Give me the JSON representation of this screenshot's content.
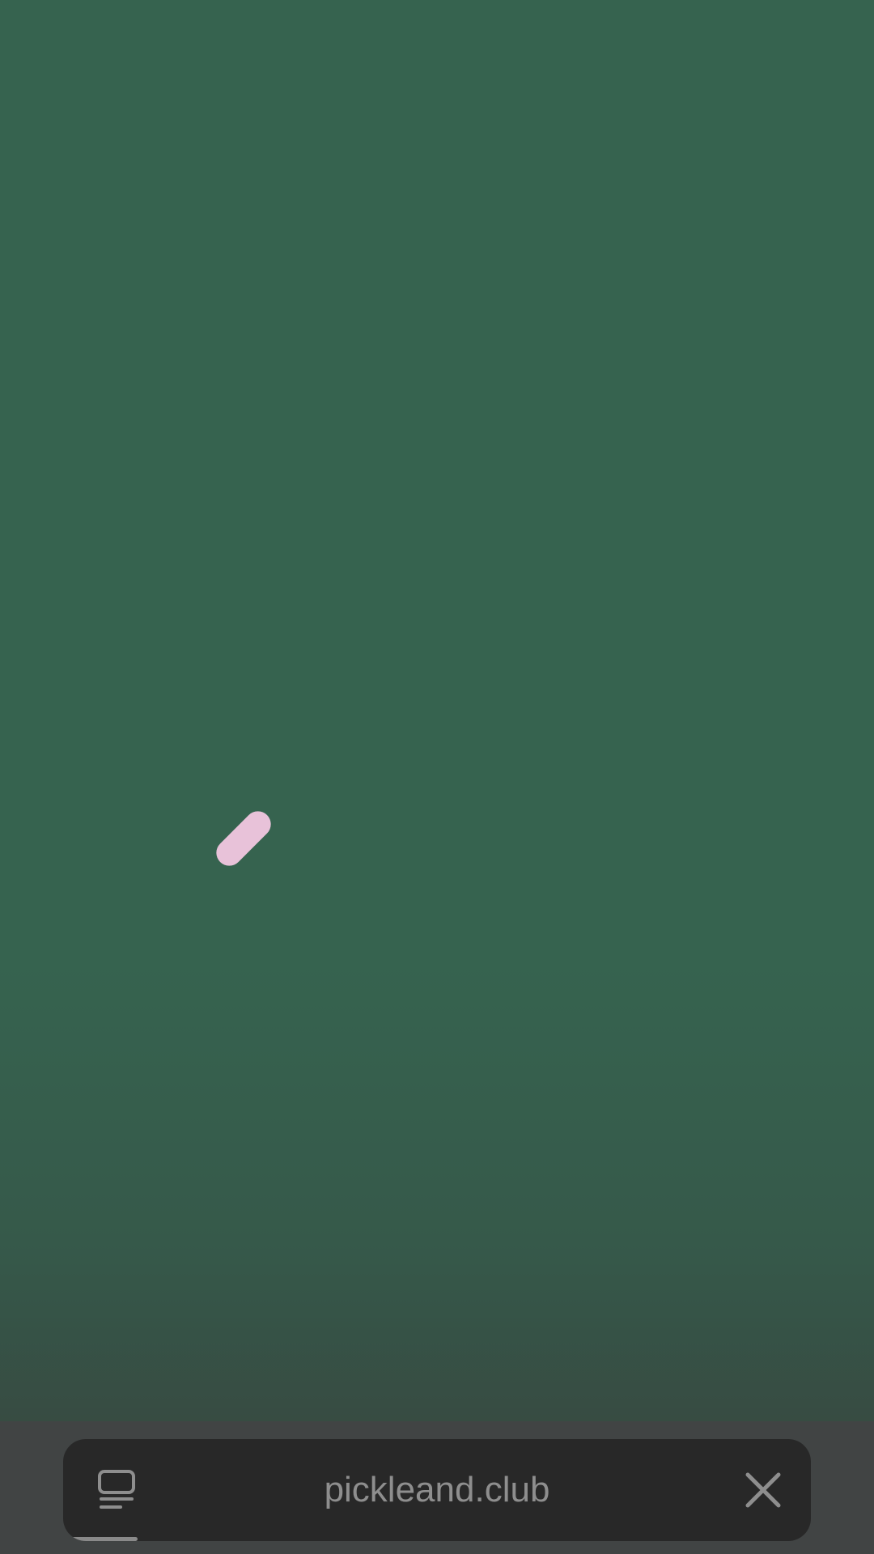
{
  "browser": {
    "url": "pickleand.club",
    "load_progress": 0.1,
    "tabs_icon": "tab-overview-icon",
    "close_icon": "close-icon"
  },
  "content": {
    "loading_indicator": "pill-shape",
    "indicator_color": "#e8c2d9",
    "background_color": "#36634f"
  }
}
